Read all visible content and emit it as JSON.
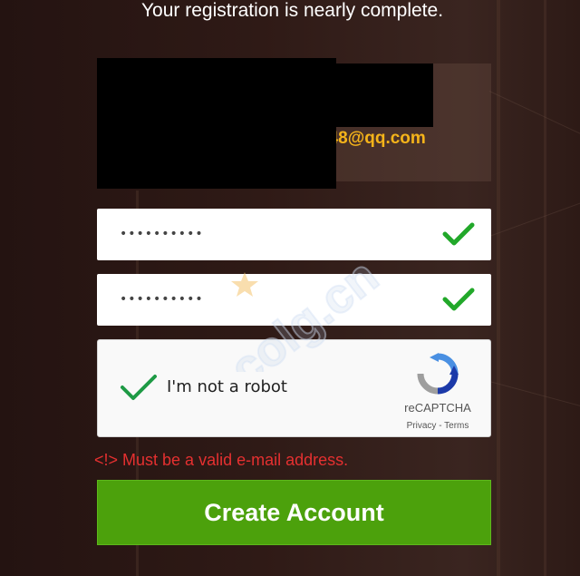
{
  "header": {
    "title": "Your registration is nearly complete."
  },
  "account": {
    "email_visible": "348@qq.com"
  },
  "fields": [
    {
      "name": "password",
      "value": "••••••••••",
      "valid": true
    },
    {
      "name": "confirm-password",
      "value": "••••••••••",
      "valid": true
    }
  ],
  "captcha": {
    "label": "I'm not a robot",
    "checked": true,
    "brand": "reCAPTCHA",
    "links": "Privacy - Terms"
  },
  "error": {
    "message": "<!> Must be a valid e-mail address."
  },
  "actions": {
    "create_account": "Create Account"
  },
  "colors": {
    "accent_green": "#4ca10c",
    "check_green": "#22a82a",
    "email_orange": "#f5b41a",
    "error_red": "#e53030"
  },
  "watermark": {
    "text": "colg.cn"
  }
}
